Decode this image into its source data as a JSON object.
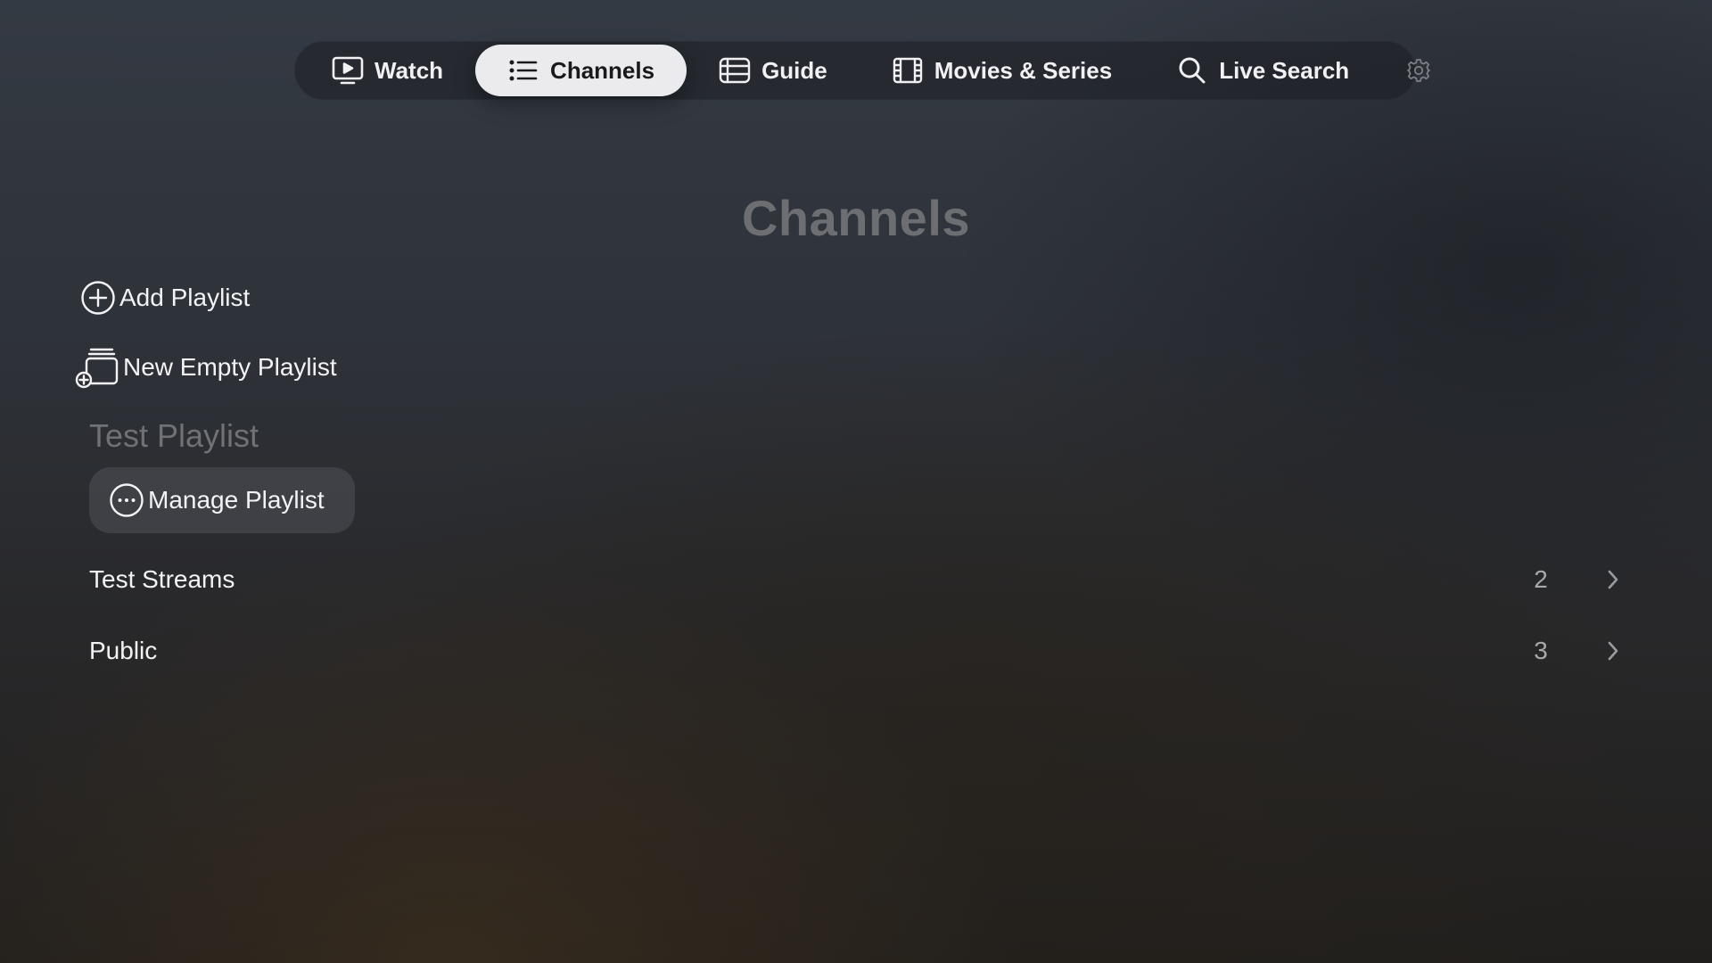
{
  "nav": {
    "tabs": [
      {
        "label": "Watch",
        "icon": "tv-play-icon",
        "active": false
      },
      {
        "label": "Channels",
        "icon": "list-icon",
        "active": true
      },
      {
        "label": "Guide",
        "icon": "guide-icon",
        "active": false
      },
      {
        "label": "Movies & Series",
        "icon": "film-icon",
        "active": false
      },
      {
        "label": "Live Search",
        "icon": "search-icon",
        "active": false
      }
    ],
    "settings_icon": "gear-icon"
  },
  "page": {
    "title": "Channels"
  },
  "actions": {
    "add_playlist": "Add Playlist",
    "new_empty_playlist": "New Empty Playlist"
  },
  "playlist": {
    "name": "Test Playlist",
    "manage_label": "Manage Playlist",
    "groups": [
      {
        "name": "Test Streams",
        "count": "2"
      },
      {
        "name": "Public",
        "count": "3"
      }
    ]
  },
  "colors": {
    "active_tab_bg": "#ebebed",
    "muted_text": "#6c6e72",
    "button_bg": "#505258"
  }
}
